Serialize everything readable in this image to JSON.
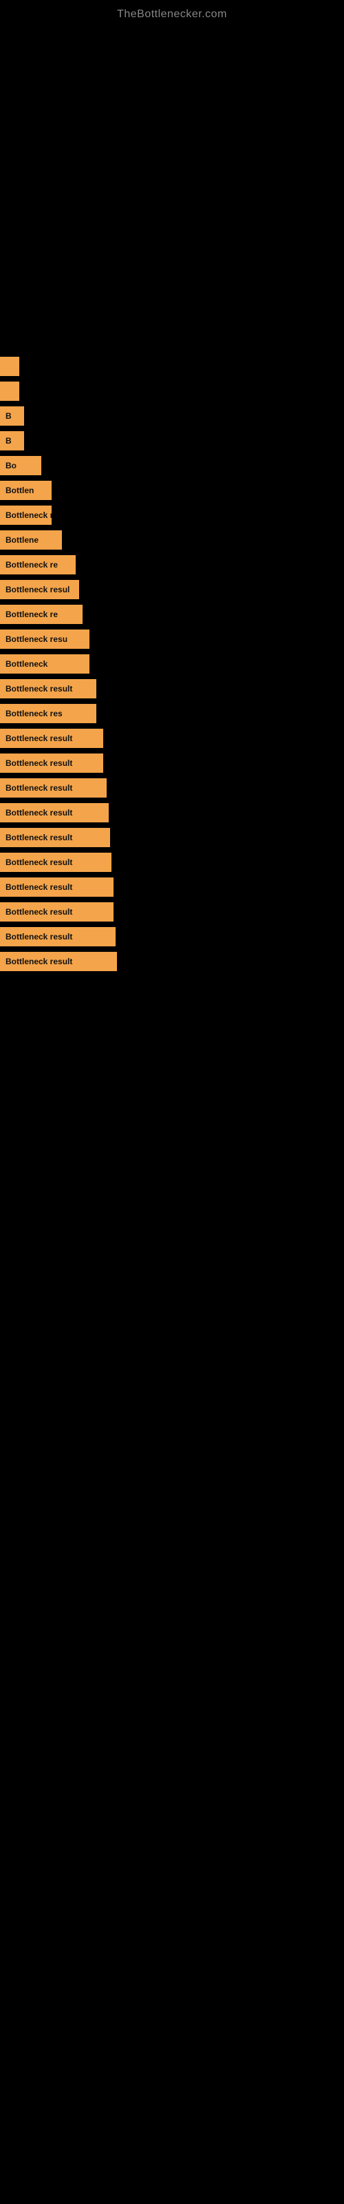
{
  "site": {
    "title": "TheBottlenecker.com"
  },
  "bars": [
    {
      "id": 1,
      "label": "",
      "width_class": "bar-1",
      "text": ""
    },
    {
      "id": 2,
      "label": "",
      "width_class": "bar-2",
      "text": ""
    },
    {
      "id": 3,
      "label": "B",
      "width_class": "bar-3",
      "text": "B"
    },
    {
      "id": 4,
      "label": "B",
      "width_class": "bar-4",
      "text": "B"
    },
    {
      "id": 5,
      "label": "Bo",
      "width_class": "bar-5",
      "text": "Bo"
    },
    {
      "id": 6,
      "label": "Bottlen",
      "width_class": "bar-6",
      "text": "Bottlen"
    },
    {
      "id": 7,
      "label": "Bottleneck r",
      "width_class": "bar-7",
      "text": "Bottleneck r"
    },
    {
      "id": 8,
      "label": "Bottlene",
      "width_class": "bar-8",
      "text": "Bottlene"
    },
    {
      "id": 9,
      "label": "Bottleneck re",
      "width_class": "bar-9",
      "text": "Bottleneck re"
    },
    {
      "id": 10,
      "label": "Bottleneck resul",
      "width_class": "bar-10",
      "text": "Bottleneck resul"
    },
    {
      "id": 11,
      "label": "Bottleneck re",
      "width_class": "bar-11",
      "text": "Bottleneck re"
    },
    {
      "id": 12,
      "label": "Bottleneck resu",
      "width_class": "bar-12",
      "text": "Bottleneck resu"
    },
    {
      "id": 13,
      "label": "Bottleneck",
      "width_class": "bar-13",
      "text": "Bottleneck"
    },
    {
      "id": 14,
      "label": "Bottleneck result",
      "width_class": "bar-14",
      "text": "Bottleneck result"
    },
    {
      "id": 15,
      "label": "Bottleneck res",
      "width_class": "bar-15",
      "text": "Bottleneck res"
    },
    {
      "id": 16,
      "label": "Bottleneck result",
      "width_class": "bar-16",
      "text": "Bottleneck result"
    },
    {
      "id": 17,
      "label": "Bottleneck result",
      "width_class": "bar-17",
      "text": "Bottleneck result"
    },
    {
      "id": 18,
      "label": "Bottleneck result",
      "width_class": "bar-18",
      "text": "Bottleneck result"
    },
    {
      "id": 19,
      "label": "Bottleneck result",
      "width_class": "bar-19",
      "text": "Bottleneck result"
    },
    {
      "id": 20,
      "label": "Bottleneck result",
      "width_class": "bar-20",
      "text": "Bottleneck result"
    },
    {
      "id": 21,
      "label": "Bottleneck result",
      "width_class": "bar-21",
      "text": "Bottleneck result"
    },
    {
      "id": 22,
      "label": "Bottleneck result",
      "width_class": "bar-22",
      "text": "Bottleneck result"
    },
    {
      "id": 23,
      "label": "Bottleneck result",
      "width_class": "bar-23",
      "text": "Bottleneck result"
    },
    {
      "id": 24,
      "label": "Bottleneck result",
      "width_class": "bar-24",
      "text": "Bottleneck result"
    },
    {
      "id": 25,
      "label": "Bottleneck result",
      "width_class": "bar-25",
      "text": "Bottleneck result"
    }
  ]
}
